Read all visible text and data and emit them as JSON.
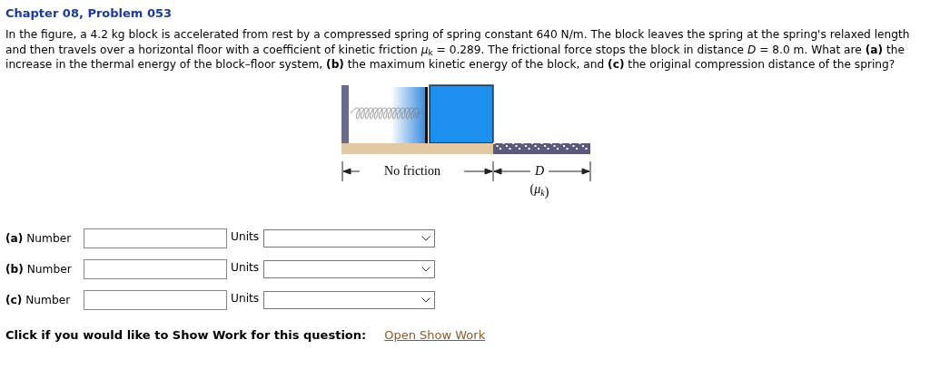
{
  "title": "Chapter 08, Problem 053",
  "problem": "In the figure, a 4.2 kg block is accelerated from rest by a compressed spring of spring constant 640 N/m. The block leaves the spring at the spring's relaxed length and then travels over a horizontal floor with a coefficient of kinetic friction *μ*$_{k}$ = 0.289. The frictional force stops the block in distance *D* = 8.0 m. What are **(a)** the increase in the thermal energy of the block–floor system, **(b)** the maximum kinetic energy of the block, and **(c)** the original compression distance of the spring?",
  "figure": {
    "labels": [
      {
        "kind": "left",
        "text": "No friction"
      },
      {
        "kind": "right",
        "text": "D"
      },
      {
        "kind": "under",
        "text": "(μ$_{k}$)"
      }
    ]
  },
  "answers": [
    {
      "part": "(a)",
      "label": "Number",
      "units_label": "Units"
    },
    {
      "part": "(b)",
      "label": "Number",
      "units_label": "Units"
    },
    {
      "part": "(c)",
      "label": "Number",
      "units_label": "Units"
    }
  ],
  "show_work": {
    "prompt": "Click if you would like to Show Work for this question:",
    "link": "Open Show Work"
  }
}
